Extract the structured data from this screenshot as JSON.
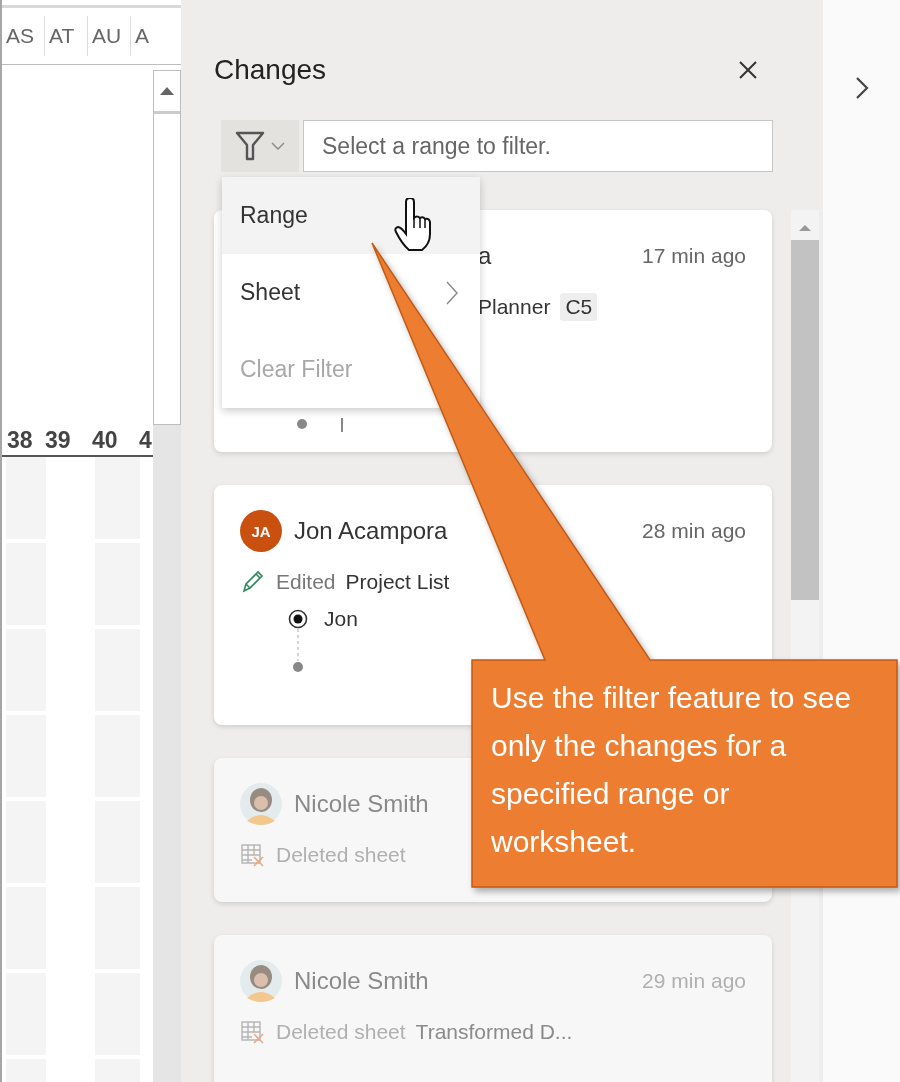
{
  "sheet": {
    "columns": [
      "AS",
      "AT",
      "AU",
      "A"
    ],
    "rows": [
      "38",
      "39",
      "40",
      "4"
    ]
  },
  "panel": {
    "title": "Changes",
    "filter_placeholder": "Select a range to filter."
  },
  "filter_menu": [
    {
      "label": "Range",
      "selected": true,
      "disabled": false,
      "submenu": false
    },
    {
      "label": "Sheet",
      "selected": false,
      "disabled": false,
      "submenu": true
    },
    {
      "label": "Clear Filter",
      "selected": false,
      "disabled": true,
      "submenu": false
    }
  ],
  "changes": [
    {
      "kind": "covered",
      "name": "a",
      "time": "17 min ago",
      "target": "Planner",
      "cell": "C5",
      "faded": false
    },
    {
      "kind": "edit",
      "initials": "JA",
      "name": "Jon Acampora",
      "time": "28 min ago",
      "verb": "Edited",
      "target": "Project List",
      "reply": "Jon",
      "faded": false
    },
    {
      "kind": "delete",
      "name": "Nicole Smith",
      "verb": "Deleted sheet",
      "faded": true
    },
    {
      "kind": "delete",
      "name": "Nicole Smith",
      "time": "29 min ago",
      "verb": "Deleted sheet",
      "target": "Transformed D...",
      "faded": true
    }
  ],
  "callout": {
    "text": "Use the filter feature to see only the changes for a specified range or worksheet."
  }
}
